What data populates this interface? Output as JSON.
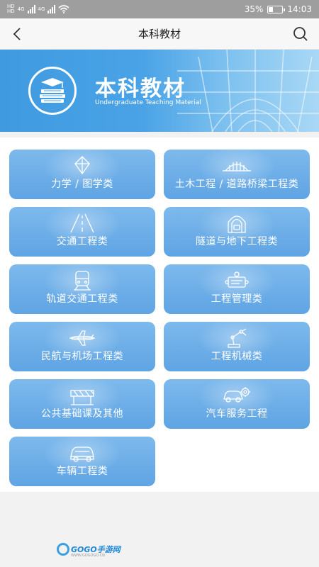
{
  "status_bar": {
    "network_left": "4G",
    "network_right": "4G",
    "battery": "35%",
    "battery_level": 0.35,
    "time": "14:03"
  },
  "nav": {
    "title": "本科教材"
  },
  "banner": {
    "title": "本科教材",
    "subtitle": "Undergraduate Teaching Material"
  },
  "categories": [
    {
      "label": "力学 / 图学类",
      "icon": "diamond-icon"
    },
    {
      "label": "土木工程 / 道路桥梁工程类",
      "icon": "bridge-icon"
    },
    {
      "label": "交通工程类",
      "icon": "road-icon"
    },
    {
      "label": "隧道与地下工程类",
      "icon": "tunnel-icon"
    },
    {
      "label": "轨道交通工程类",
      "icon": "train-icon"
    },
    {
      "label": "工程管理类",
      "icon": "management-icon"
    },
    {
      "label": "民航与机场工程类",
      "icon": "airplane-icon"
    },
    {
      "label": "工程机械类",
      "icon": "robot-arm-icon"
    },
    {
      "label": "公共基础课及其他",
      "icon": "barrier-icon"
    },
    {
      "label": "汽车服务工程",
      "icon": "car-gear-icon"
    },
    {
      "label": "车辆工程类",
      "icon": "car-icon"
    }
  ],
  "watermark": {
    "text": "GOGO手游网",
    "url": "WWW.GOGOGO.CN"
  }
}
